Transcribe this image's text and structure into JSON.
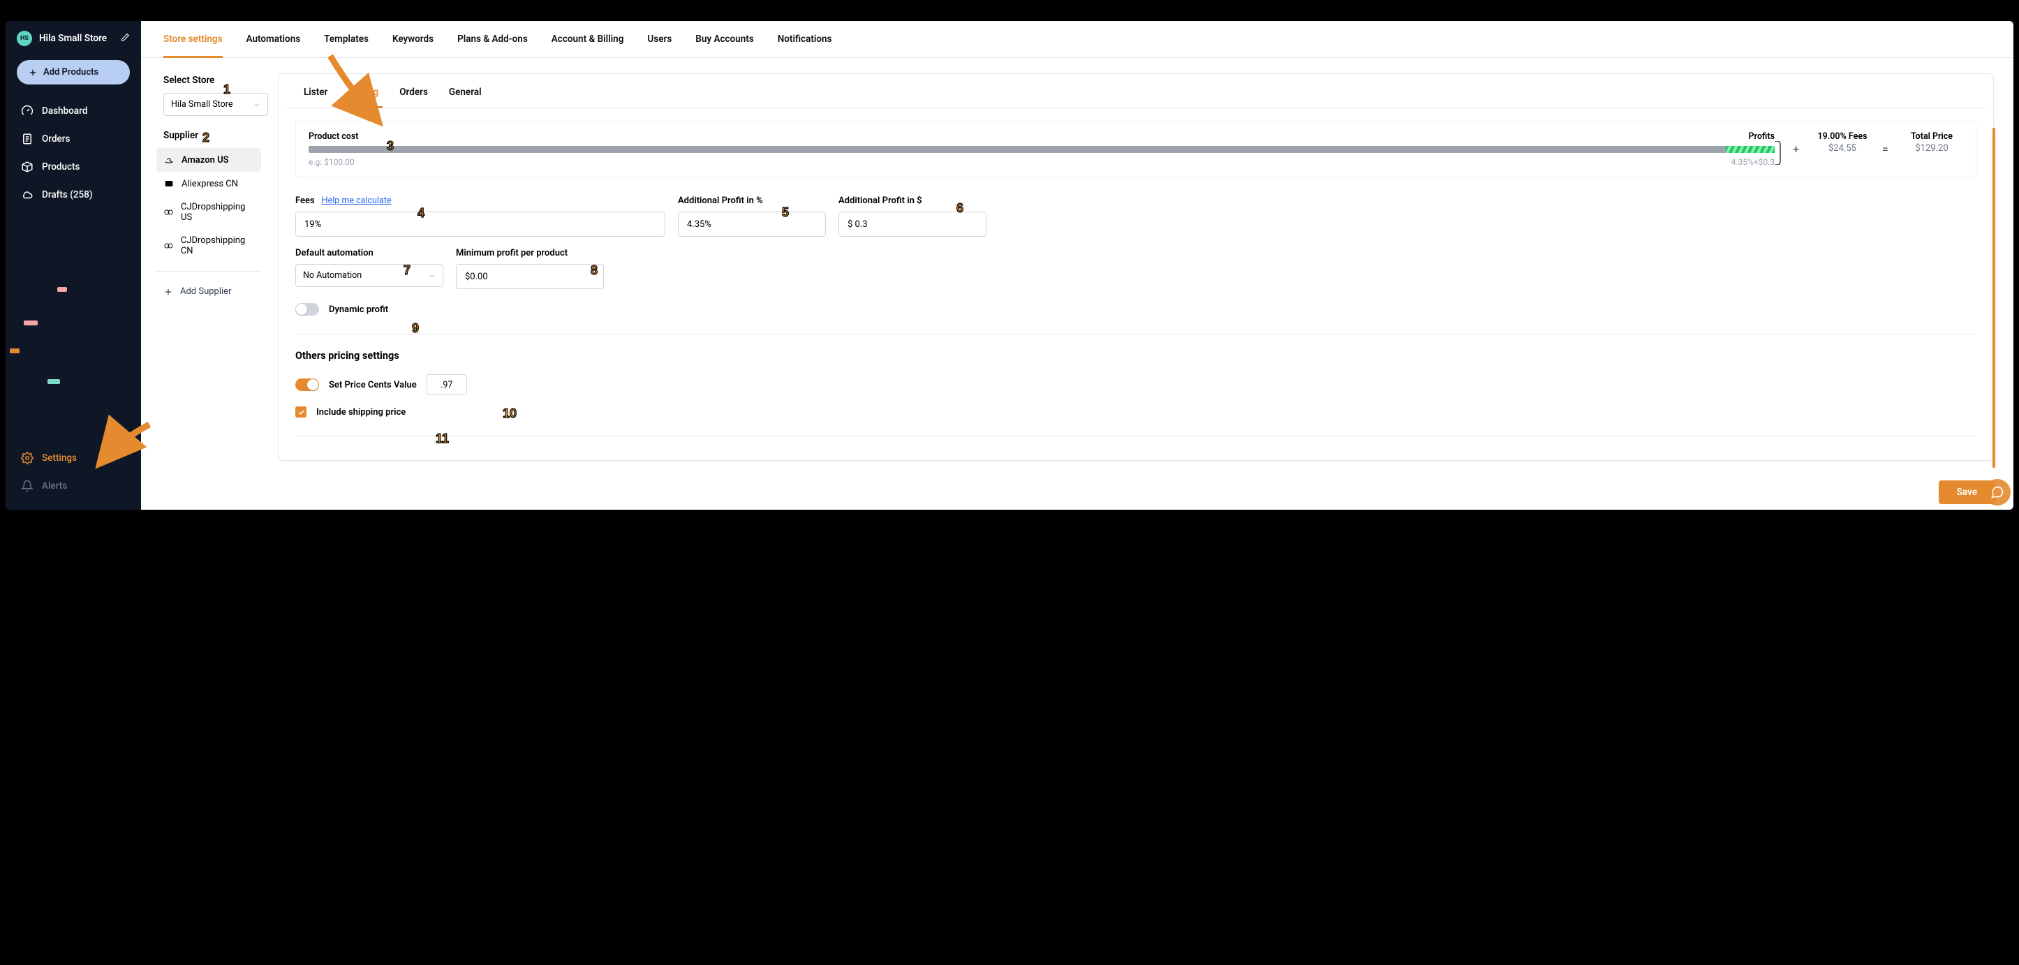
{
  "sidebar": {
    "store_badge": "HS",
    "store_name": "Hila Small Store",
    "add_products": "Add Products",
    "nav": {
      "dashboard": "Dashboard",
      "orders": "Orders",
      "products": "Products",
      "drafts": "Drafts (258)",
      "settings": "Settings",
      "alerts": "Alerts"
    }
  },
  "top_tabs": {
    "store_settings": "Store settings",
    "automations": "Automations",
    "templates": "Templates",
    "keywords": "Keywords",
    "plans": "Plans & Add-ons",
    "account": "Account & Billing",
    "users": "Users",
    "buy_accounts": "Buy Accounts",
    "notifications": "Notifications"
  },
  "left_col": {
    "select_store_label": "Select Store",
    "selected_store": "Hila Small Store",
    "supplier_label": "Supplier",
    "suppliers": {
      "amazon": "Amazon US",
      "aliexpress": "Aliexpress CN",
      "cj_us": "CJDropshipping US",
      "cj_cn": "CJDropshipping CN"
    },
    "add_supplier": "Add Supplier"
  },
  "sub_tabs": {
    "lister": "Lister",
    "pricing": "Pricing",
    "orders": "Orders",
    "general": "General"
  },
  "price_box": {
    "product_cost_label": "Product cost",
    "example": "e.g: $100.00",
    "profits_label": "Profits",
    "profit_formula": "4.35%+$0.3",
    "fees_label": "19.00% Fees",
    "fees_value": "$24.55",
    "total_label": "Total Price",
    "total_value": "$129.20"
  },
  "fields": {
    "fees_label": "Fees",
    "help_link": "Help me calculate",
    "fees_value": "19%",
    "profit_pct_label": "Additional Profit in %",
    "profit_pct_value": "4.35%",
    "profit_dollar_label": "Additional Profit in $",
    "profit_dollar_value": "$ 0.3",
    "default_automation_label": "Default automation",
    "default_automation_value": "No Automation",
    "min_profit_label": "Minimum profit per product",
    "min_profit_value": "$0.00",
    "dynamic_profit_label": "Dynamic profit"
  },
  "other_settings": {
    "title": "Others pricing settings",
    "set_cents_label": "Set Price Cents Value",
    "cents_value": ".97",
    "include_shipping_label": "Include shipping price"
  },
  "save_label": "Save",
  "plus": "+",
  "equals": "=",
  "annotations": {
    "n1": "1",
    "n2": "2",
    "n3": "3",
    "n4": "4",
    "n5": "5",
    "n6": "6",
    "n7": "7",
    "n8": "8",
    "n9": "9",
    "n10": "10",
    "n11": "11"
  }
}
